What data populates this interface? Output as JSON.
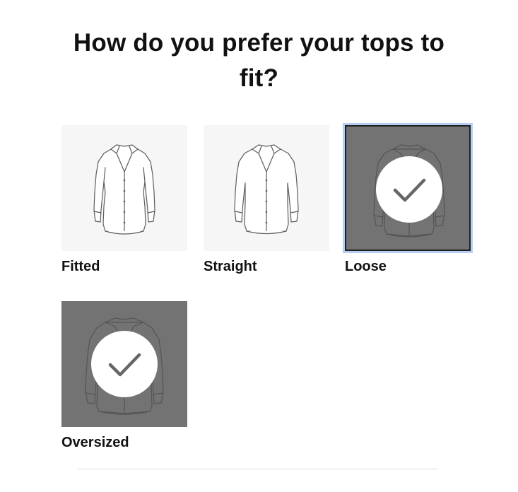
{
  "question": {
    "title": "How do you prefer your tops to fit?"
  },
  "options": [
    {
      "label": "Fitted",
      "selected": false,
      "icon": "fitted-shirt-icon"
    },
    {
      "label": "Straight",
      "selected": false,
      "icon": "straight-shirt-icon"
    },
    {
      "label": "Loose",
      "selected": true,
      "icon": "loose-shirt-icon"
    },
    {
      "label": "Oversized",
      "selected": true,
      "icon": "oversized-shirt-icon"
    }
  ],
  "colors": {
    "tile_background": "#f6f6f6",
    "selected_overlay": "#737373",
    "focus_ring": "#b7cdf2",
    "checkmark": "#666666"
  }
}
